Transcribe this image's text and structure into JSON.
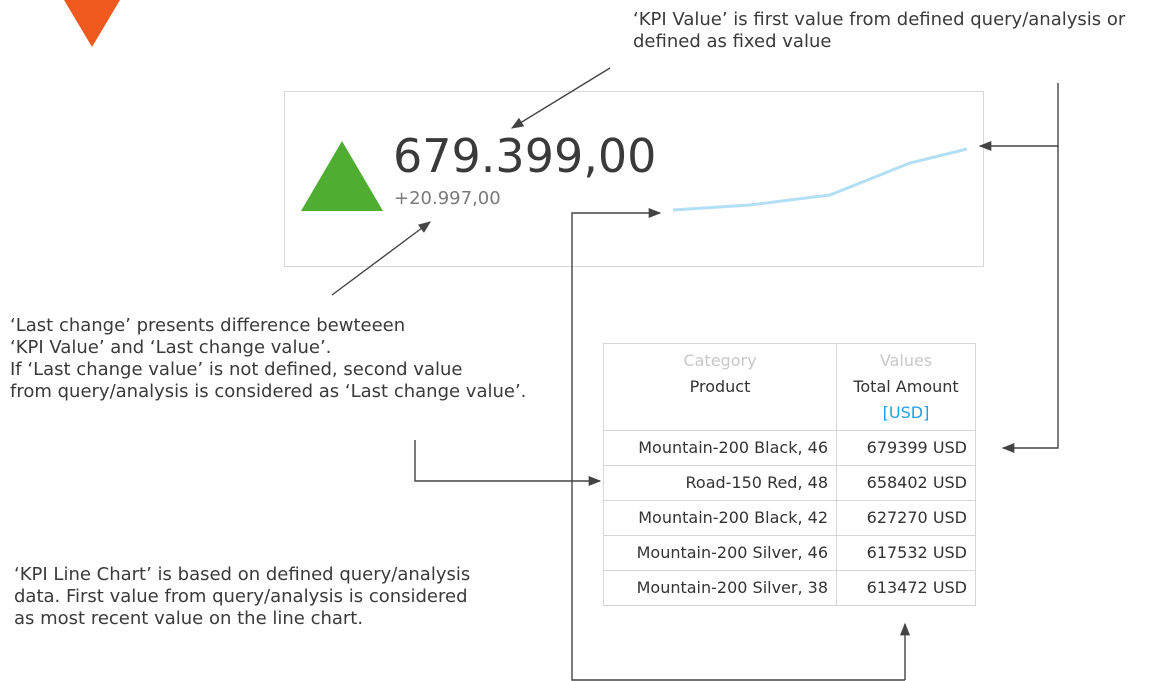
{
  "annotations": {
    "kpi_value_note": "‘KPI Value’ is first value from defined query/analysis or\ndefined as fixed value",
    "last_change_note": "‘Last change’ presents difference bewteeen\n‘KPI Value’ and ‘Last change value’.\nIf ‘Last change value’ is not defined, second value\nfrom query/analysis is considered as ‘Last change value’.",
    "line_chart_note": "‘KPI Line Chart’ is based on defined query/analysis\ndata. First value from query/analysis is considered\nas most recent value on the line chart."
  },
  "kpi": {
    "value": "679.399,00",
    "last_change": "+20.997,00",
    "trend": "up",
    "colors": {
      "up_triangle": "#4fae32",
      "logo": "#f05a1e",
      "sparkline": "#b3dff5"
    }
  },
  "table": {
    "headers": [
      {
        "top": "Category",
        "main": "Product",
        "unit": ""
      },
      {
        "top": "Values",
        "main": "Total Amount",
        "unit": "[USD]"
      }
    ],
    "rows": [
      {
        "product": "Mountain-200 Black, 46",
        "amount": "679399",
        "unit": "USD"
      },
      {
        "product": "Road-150 Red, 48",
        "amount": "658402",
        "unit": "USD"
      },
      {
        "product": "Mountain-200 Black, 42",
        "amount": "627270",
        "unit": "USD"
      },
      {
        "product": "Mountain-200 Silver, 46",
        "amount": "617532",
        "unit": "USD"
      },
      {
        "product": "Mountain-200 Silver, 38",
        "amount": "613472",
        "unit": "USD"
      }
    ]
  }
}
